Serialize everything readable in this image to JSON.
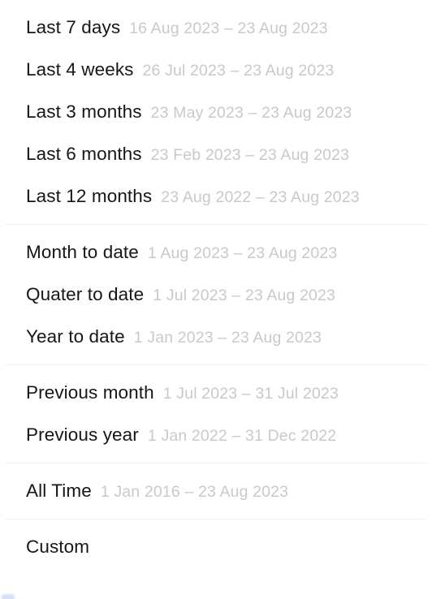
{
  "menu": {
    "name": "date-range-preset-menu",
    "accent_color": "#4a74d8",
    "label_color": "#161616",
    "range_color": "#c9c9c9",
    "divider_color": "#f0f0f0",
    "background_color": "#ffffff",
    "groups": [
      {
        "id": "relative-ranges",
        "options": [
          {
            "label": "Last 7 days",
            "range": "16 Aug 2023 – 23 Aug 2023"
          },
          {
            "label": "Last 4 weeks",
            "range": "26 Jul 2023 – 23 Aug 2023"
          },
          {
            "label": "Last 3 months",
            "range": "23 May 2023 – 23 Aug 2023"
          },
          {
            "label": "Last 6 months",
            "range": "23 Feb 2023 – 23 Aug 2023"
          },
          {
            "label": "Last 12 months",
            "range": "23 Aug 2022 – 23 Aug 2023"
          }
        ]
      },
      {
        "id": "to-date-ranges",
        "options": [
          {
            "label": "Month to date",
            "range": "1 Aug 2023 – 23 Aug 2023"
          },
          {
            "label": "Quater to date",
            "range": "1 Jul 2023 – 23 Aug 2023"
          },
          {
            "label": "Year to date",
            "range": "1 Jan 2023 – 23 Aug 2023"
          }
        ]
      },
      {
        "id": "previous-ranges",
        "options": [
          {
            "label": "Previous month",
            "range": "1 Jul 2023 – 31 Jul 2023"
          },
          {
            "label": "Previous year",
            "range": "1 Jan 2022 – 31 Dec 2022"
          }
        ]
      },
      {
        "id": "all-time-range",
        "options": [
          {
            "label": "All Time",
            "range": "1 Jan 2016 – 23 Aug 2023"
          }
        ]
      },
      {
        "id": "custom-range",
        "options": [
          {
            "label": "Custom",
            "range": ""
          }
        ]
      }
    ]
  }
}
